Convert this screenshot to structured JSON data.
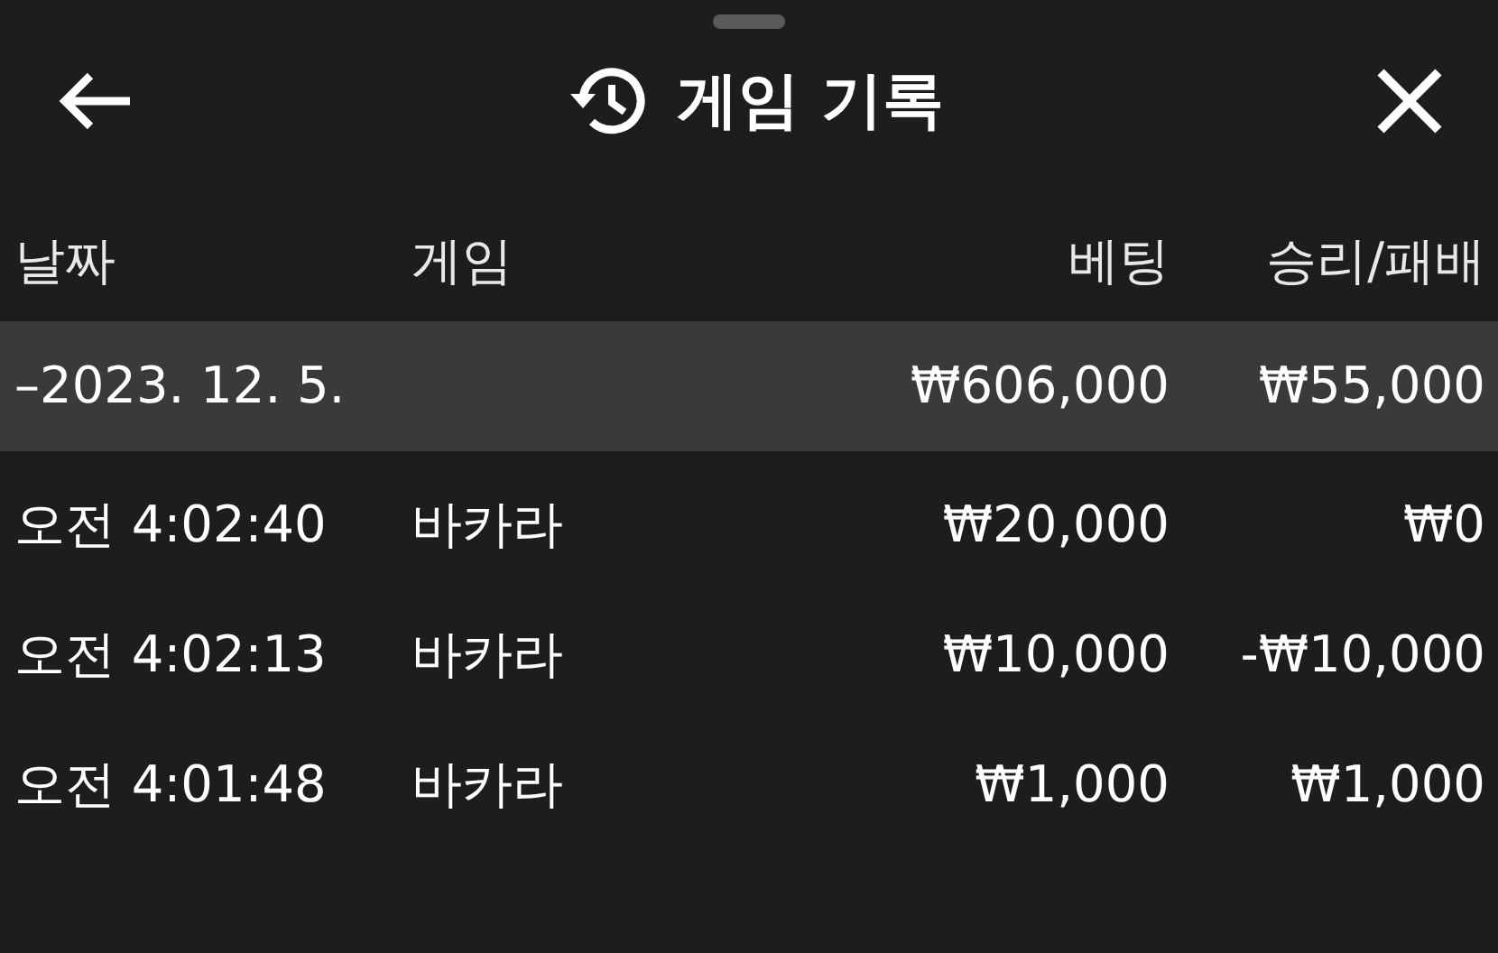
{
  "header": {
    "title": "게임 기록"
  },
  "columns": [
    "날짜",
    "게임",
    "베팅",
    "승리/패배"
  ],
  "groups": [
    {
      "date": "–2023. 12. 5.",
      "bet": "₩606,000",
      "result": "₩55,000",
      "rows": [
        {
          "time": "오전 4:02:40",
          "game": "바카라",
          "bet": "₩20,000",
          "result": "₩0"
        },
        {
          "time": "오전 4:02:13",
          "game": "바카라",
          "bet": "₩10,000",
          "result": "-₩10,000"
        },
        {
          "time": "오전 4:01:48",
          "game": "바카라",
          "bet": "₩1,000",
          "result": "₩1,000"
        }
      ]
    }
  ]
}
